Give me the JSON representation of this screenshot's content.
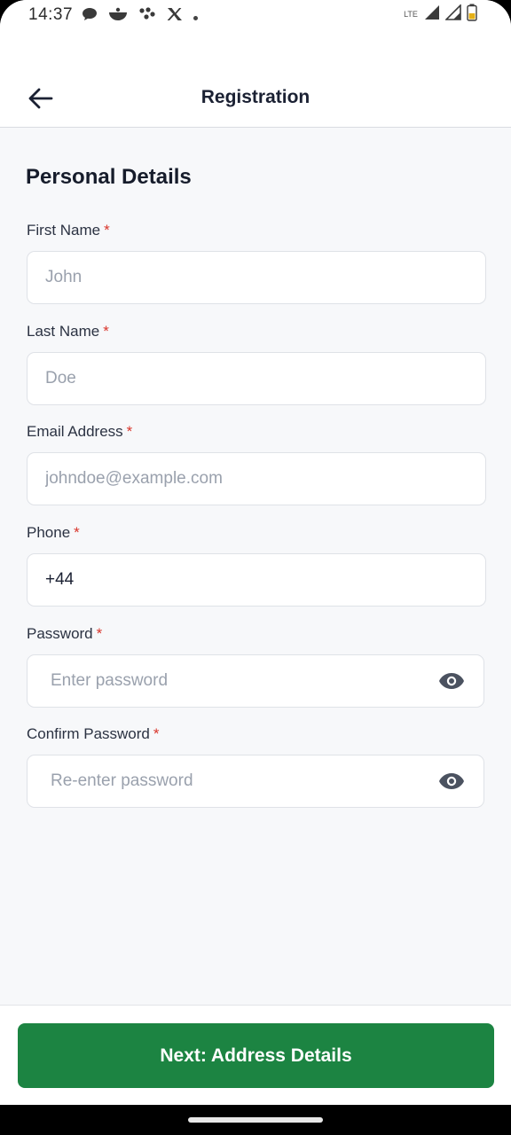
{
  "status_bar": {
    "time": "14:37",
    "network_label": "LTE"
  },
  "header": {
    "title": "Registration",
    "back_icon": "arrow-left-icon"
  },
  "form": {
    "section_title": "Personal Details",
    "required_marker": "*",
    "fields": [
      {
        "label": "First Name",
        "placeholder": "John",
        "value": ""
      },
      {
        "label": "Last Name",
        "placeholder": "Doe",
        "value": ""
      },
      {
        "label": "Email Address",
        "placeholder": "johndoe@example.com",
        "value": ""
      },
      {
        "label": "Phone",
        "placeholder": "",
        "value": "+44"
      },
      {
        "label": "Password",
        "placeholder": "Enter password",
        "value": ""
      },
      {
        "label": "Confirm Password",
        "placeholder": "Re-enter password",
        "value": ""
      }
    ],
    "password_toggle_icon": "eye-icon"
  },
  "footer": {
    "next_label": "Next: Address Details"
  },
  "colors": {
    "primary": "#1c8442",
    "required": "#d9362c",
    "background": "#f7f8fa"
  }
}
